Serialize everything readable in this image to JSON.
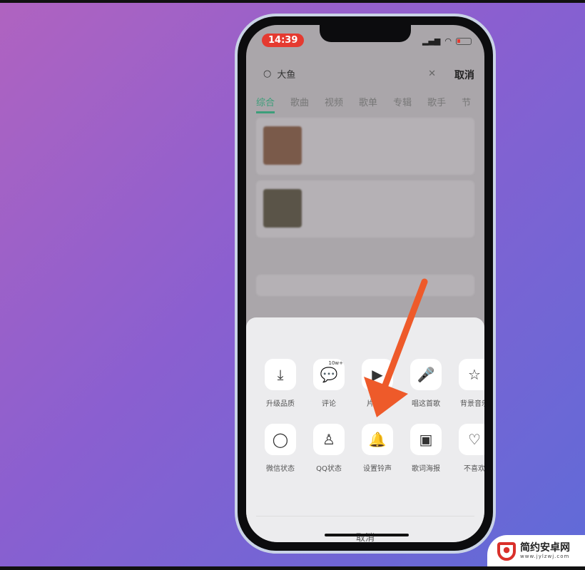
{
  "status": {
    "time": "14:39"
  },
  "search": {
    "query": "大鱼",
    "cancel": "取消"
  },
  "tabs": [
    "综合",
    "歌曲",
    "视频",
    "歌单",
    "专辑",
    "歌手",
    "节"
  ],
  "sheet": {
    "row1": [
      {
        "icon": "download-quality-icon",
        "label": "升级品质"
      },
      {
        "icon": "comment-icon",
        "label": "评论",
        "badge": "10w+"
      },
      {
        "icon": "clip-icon",
        "label": "片段拍"
      },
      {
        "icon": "microphone-icon",
        "label": "唱这首歌"
      },
      {
        "icon": "star-music-icon",
        "label": "背景音乐"
      }
    ],
    "row2": [
      {
        "icon": "wechat-status-icon",
        "label": "微信状态"
      },
      {
        "icon": "qq-status-icon",
        "label": "QQ状态"
      },
      {
        "icon": "bell-icon",
        "label": "设置铃声"
      },
      {
        "icon": "lyrics-poster-icon",
        "label": "歌词海报"
      },
      {
        "icon": "dislike-icon",
        "label": "不喜欢"
      }
    ],
    "cancel": "取消"
  },
  "annotation": {
    "arrow_color": "#ee5a2a"
  },
  "watermark": {
    "title": "简约安卓网",
    "url": "www.jylzwj.com"
  }
}
